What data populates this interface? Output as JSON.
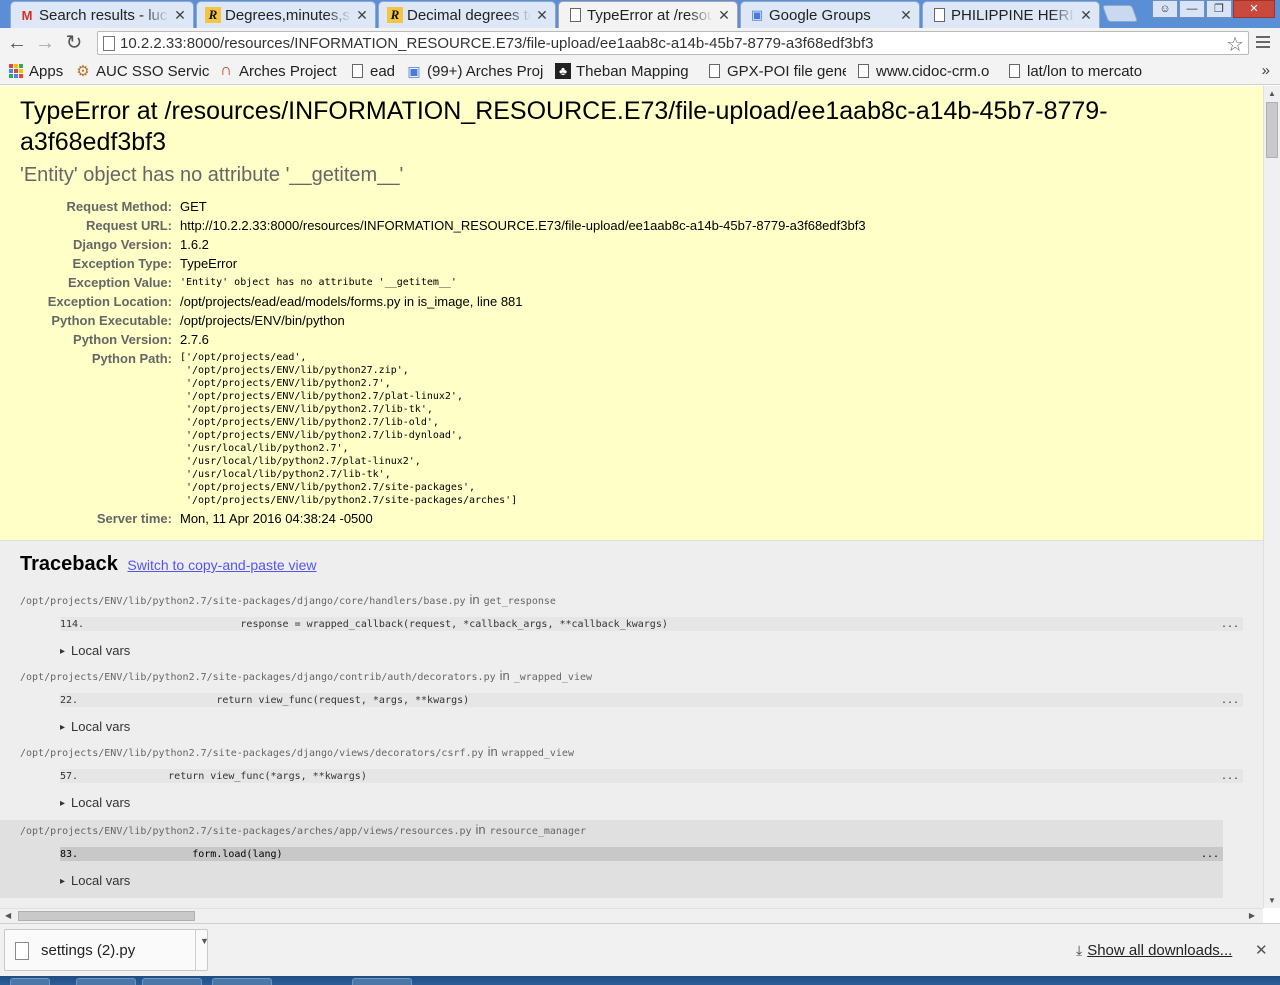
{
  "browser": {
    "tabs": [
      {
        "title": "Search results - luc",
        "icon": "gmail-icon",
        "icon_glyph": "M",
        "icon_color": "#d93025",
        "active": false
      },
      {
        "title": "Degrees,minutes,se",
        "icon": "r-logo-icon",
        "icon_glyph": "R",
        "icon_color": "#111111",
        "active": false
      },
      {
        "title": "Decimal degrees to",
        "icon": "r-logo-icon",
        "icon_glyph": "R",
        "icon_color": "#111111",
        "active": false
      },
      {
        "title": "TypeError at /resou",
        "icon": "page-icon",
        "icon_glyph": "",
        "icon_color": "#555555",
        "active": true
      },
      {
        "title": "Google Groups",
        "icon": "google-groups-icon",
        "icon_glyph": "▣",
        "icon_color": "#4a7bd8",
        "active": false
      },
      {
        "title": "PHILIPPINE HERITA",
        "icon": "page-icon",
        "icon_glyph": "",
        "icon_color": "#555555",
        "active": false
      }
    ],
    "url": "10.2.2.33:8000/resources/INFORMATION_RESOURCE.E73/file-upload/ee1aab8c-a14b-45b7-8779-a3f68edf3bf3",
    "bookmarks": [
      {
        "label": "Apps",
        "icon": "apps-grid-icon"
      },
      {
        "label": "AUC SSO Service",
        "icon": "gear-badge-icon"
      },
      {
        "label": "Arches Project",
        "icon": "arches-arch-icon"
      },
      {
        "label": "ead",
        "icon": "page-icon"
      },
      {
        "label": "(99+) Arches Proj",
        "icon": "google-groups-icon"
      },
      {
        "label": "Theban Mapping",
        "icon": "theban-mapping-icon"
      },
      {
        "label": "GPX-POI file gene",
        "icon": "page-icon"
      },
      {
        "label": "www.cidoc-crm.o",
        "icon": "page-icon"
      },
      {
        "label": "lat/lon to mercato",
        "icon": "page-icon"
      }
    ],
    "colors": {
      "tabstrip": "#5a8fd6",
      "toolbar": "#f3f3f3",
      "summary_bg": "#ffffc8",
      "link": "#5555ee"
    }
  },
  "error": {
    "title": "TypeError at /resources/INFORMATION_RESOURCE.E73/file-upload/ee1aab8c-a14b-45b7-8779-a3f68edf3bf3",
    "message": "'Entity' object has no attribute '__getitem__'",
    "meta": [
      {
        "label": "Request Method:",
        "value": "GET",
        "mono": false
      },
      {
        "label": "Request URL:",
        "value": "http://10.2.2.33:8000/resources/INFORMATION_RESOURCE.E73/file-upload/ee1aab8c-a14b-45b7-8779-a3f68edf3bf3",
        "mono": false
      },
      {
        "label": "Django Version:",
        "value": "1.6.2",
        "mono": false
      },
      {
        "label": "Exception Type:",
        "value": "TypeError",
        "mono": false
      },
      {
        "label": "Exception Value:",
        "value": "'Entity' object has no attribute '__getitem__'",
        "mono": true
      },
      {
        "label": "Exception Location:",
        "value": "/opt/projects/ead/ead/models/forms.py in is_image, line 881",
        "mono": false
      },
      {
        "label": "Python Executable:",
        "value": "/opt/projects/ENV/bin/python",
        "mono": false
      },
      {
        "label": "Python Version:",
        "value": "2.7.6",
        "mono": false
      }
    ],
    "python_path_label": "Python Path:",
    "python_path": [
      "['/opt/projects/ead',",
      " '/opt/projects/ENV/lib/python27.zip',",
      " '/opt/projects/ENV/lib/python2.7',",
      " '/opt/projects/ENV/lib/python2.7/plat-linux2',",
      " '/opt/projects/ENV/lib/python2.7/lib-tk',",
      " '/opt/projects/ENV/lib/python2.7/lib-old',",
      " '/opt/projects/ENV/lib/python2.7/lib-dynload',",
      " '/usr/local/lib/python2.7',",
      " '/usr/local/lib/python2.7/plat-linux2',",
      " '/usr/local/lib/python2.7/lib-tk',",
      " '/opt/projects/ENV/lib/python2.7/site-packages',",
      " '/opt/projects/ENV/lib/python2.7/site-packages/arches']"
    ],
    "server_time_label": "Server time:",
    "server_time": "Mon, 11 Apr 2016 04:38:24 -0500"
  },
  "traceback": {
    "heading": "Traceback",
    "switch_link": "Switch to copy-and-paste view",
    "in_word": "in",
    "local_vars_label": "Local vars",
    "frames": [
      {
        "file": "/opt/projects/ENV/lib/python2.7/site-packages/django/core/handlers/base.py",
        "func": "get_response",
        "lineno": "114.",
        "code": "                    response = wrapped_callback(request, *callback_args, **callback_kwargs)",
        "dots": "...",
        "user": false
      },
      {
        "file": "/opt/projects/ENV/lib/python2.7/site-packages/django/contrib/auth/decorators.py",
        "func": "_wrapped_view",
        "lineno": "22.",
        "code": "                return view_func(request, *args, **kwargs)",
        "dots": "...",
        "user": false
      },
      {
        "file": "/opt/projects/ENV/lib/python2.7/site-packages/django/views/decorators/csrf.py",
        "func": "wrapped_view",
        "lineno": "57.",
        "code": "        return view_func(*args, **kwargs)",
        "dots": "...",
        "user": false
      },
      {
        "file": "/opt/projects/ENV/lib/python2.7/site-packages/arches/app/views/resources.py",
        "func": "resource_manager",
        "lineno": "83.",
        "code": "            form.load(lang)",
        "dots": "...",
        "user": true
      }
    ]
  },
  "downloads": {
    "file_name": "settings (2).py",
    "show_all": "Show all downloads..."
  }
}
